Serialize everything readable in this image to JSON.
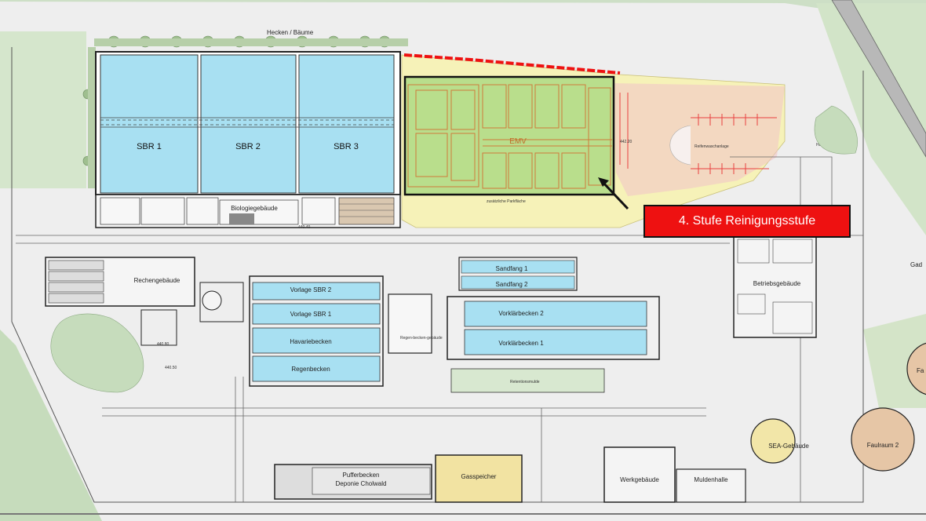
{
  "callout": {
    "text": "4. Stufe Reinigungsstufe",
    "color": "#ee1111"
  },
  "labels": {
    "hecken": "Hecken / Bäume",
    "sbr1": "SBR 1",
    "sbr2": "SBR 2",
    "sbr3": "SBR 3",
    "biologie": "Biologiegebäude",
    "emv": "EMV",
    "rechen": "Rechengebäude",
    "vorlage_sbr2": "Vorlage SBR 2",
    "vorlage_sbr1": "Vorlage SBR 1",
    "havarie": "Havariebecken",
    "regen": "Regenbecken",
    "sandfang1": "Sandfang 1",
    "sandfang2": "Sandfang 2",
    "vorklaer2": "Vorklärbecken 2",
    "vorklaer1": "Vorklärbecken 1",
    "betrieb": "Betriebsgebäude",
    "puffer1": "Pufferbecken",
    "puffer2": "Deponie Cholwald",
    "gas": "Gasspeicher",
    "werk": "Werkgebäude",
    "mulden": "Muldenhalle",
    "sea": "SEA-Gebäude",
    "faul2": "Faulraum 2",
    "faul1_partial": "Fa",
    "gad_partial": "Gad",
    "hauptzufahrt": "Hauptzufahrt",
    "reifenwasch": "Reifenwaschanlage",
    "parkflaeche": "zusätzliche Parkfläche",
    "retention": "Retentionsmulde",
    "regenbecken_small": "Regen-becken-gebäude",
    "level_44220": "442.20",
    "level_44080": "440.80",
    "level_44050": "440.50",
    "level_44040": "440.40"
  },
  "colors": {
    "basin_blue": "#a8e0f2",
    "emv_green": "#b9de8c",
    "emv_outline": "#d07a3a",
    "extension_yellow": "#f6f2b8",
    "grass": "#c6dcbc",
    "gas_yellow": "#f2e3a2",
    "digester": "#e6c6a6",
    "pink_parking": "#f2c6c6"
  },
  "icons": {
    "callout_arrow": "arrow-icon"
  }
}
